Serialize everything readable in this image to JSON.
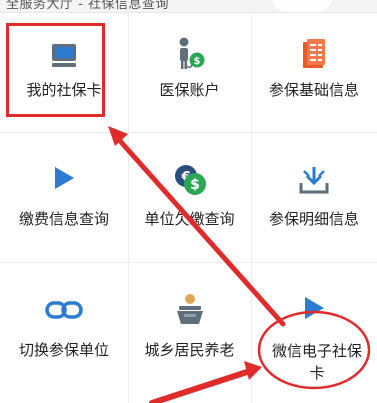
{
  "top_bar": {
    "text": "全服务大厅 - 社保信息查询"
  },
  "grid": {
    "items": [
      {
        "label": "我的社保卡",
        "icon": "social-security-card-icon"
      },
      {
        "label": "医保账户",
        "icon": "medical-insurance-account-icon"
      },
      {
        "label": "参保基础信息",
        "icon": "basic-info-document-icon"
      },
      {
        "label": "缴费信息查询",
        "icon": "play-triangle-icon"
      },
      {
        "label": "单位欠缴查询",
        "icon": "arrears-coins-icon"
      },
      {
        "label": "参保明细信息",
        "icon": "download-tray-icon"
      },
      {
        "label": "切换参保单位",
        "icon": "switch-link-icon"
      },
      {
        "label": "城乡居民养老",
        "icon": "elderly-pension-icon"
      },
      {
        "label": "微信电子社保卡",
        "icon": "play-triangle-icon"
      }
    ]
  },
  "annotation": {
    "color": "#e02b2b"
  },
  "colors": {
    "blue": "#2b7bd0",
    "green": "#2aa654",
    "orange": "#ef5a24",
    "gray": "#5e6e7a"
  }
}
